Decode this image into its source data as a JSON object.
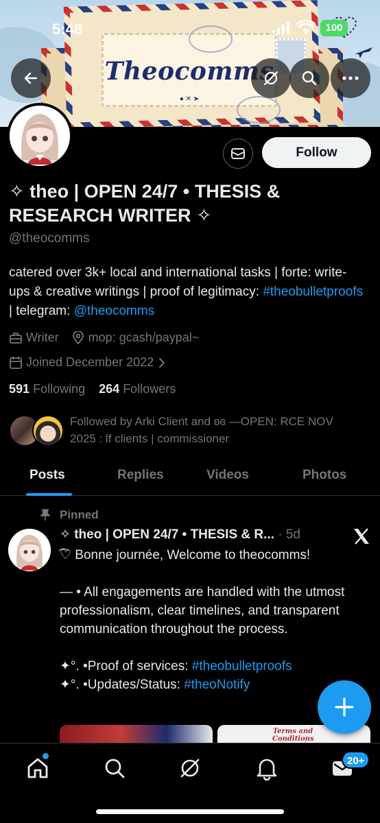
{
  "status_bar": {
    "time": "5:48",
    "battery": "100"
  },
  "banner": {
    "brand": "Theocomms",
    "accent": "#1e2d6b"
  },
  "profile": {
    "display_name": "✧ theo | OPEN 24/7 • THESIS & RESEARCH WRITER ✧",
    "handle": "@theocomms",
    "bio_text_1": "catered over 3k+ local and international tasks | forte: write-ups & creative writings | proof of legitimacy: ",
    "bio_link_1": "#theobulletproofs",
    "bio_text_2": " | telegram: ",
    "bio_link_2": "@theocomms",
    "category": "Writer",
    "location": "mop: gcash/paypal~",
    "joined": "Joined December 2022",
    "following_count": "591",
    "following_label": "Following",
    "followers_count": "264",
    "followers_label": "Followers",
    "followed_by": "Followed by Arki Client and ʚɞ —OPEN: RCE NOV 2025 : lf clients | commissioner",
    "follow_label": "Follow"
  },
  "tabs": [
    {
      "label": "Posts"
    },
    {
      "label": "Replies"
    },
    {
      "label": "Videos"
    },
    {
      "label": "Photos"
    }
  ],
  "post": {
    "pinned_label": "Pinned",
    "author": "✧ theo | OPEN 24/7 • THESIS & R...",
    "time_ago": " · 5d",
    "line1": "͡♡ Bonne journée, Welcome to theocomms!",
    "para2": "— • All engagements are handled with the utmost professionalism, clear timelines, and transparent communication throughout the process.",
    "line3_prefix": "✦°.   •Proof of services: ",
    "line3_link": "#theobulletproofs",
    "line4_prefix": "✦°.   •Updates/Status: ",
    "line4_link": "#theoNotify",
    "media_label": "Terms and Conditions"
  },
  "nav": {
    "messages_badge": "20+"
  },
  "colors": {
    "link": "#1d9bf0",
    "muted": "#71767b",
    "text": "#e7e9ea",
    "bg": "#000000"
  }
}
